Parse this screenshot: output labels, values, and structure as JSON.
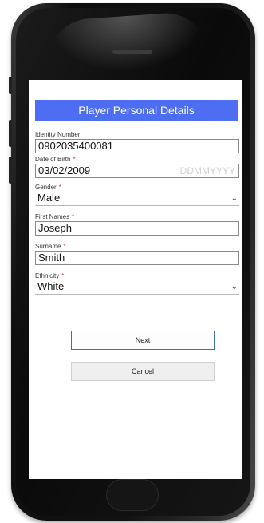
{
  "form": {
    "title": "Player Personal Details",
    "fields": {
      "identity": {
        "label": "Identity Number",
        "value": "0902035400081"
      },
      "dob": {
        "label": "Date of Birth",
        "required_mark": "*",
        "value": "03/02/2009",
        "placeholder": "DDMMYYYY"
      },
      "gender": {
        "label": "Gender",
        "required_mark": "*",
        "value": "Male"
      },
      "first_names": {
        "label": "First Names",
        "required_mark": "*",
        "value": "Joseph"
      },
      "surname": {
        "label": "Surname",
        "required_mark": "*",
        "value": "Smith"
      },
      "ethnicity": {
        "label": "Ethnicity",
        "required_mark": "*",
        "value": "White"
      }
    },
    "buttons": {
      "next": "Next",
      "cancel": "Cancel"
    }
  },
  "colors": {
    "title_bar": "#4d6ef2",
    "required": "#e0312f",
    "next_border": "#3d6fb3"
  },
  "icons": {
    "dropdown": "chevron-down-icon"
  }
}
